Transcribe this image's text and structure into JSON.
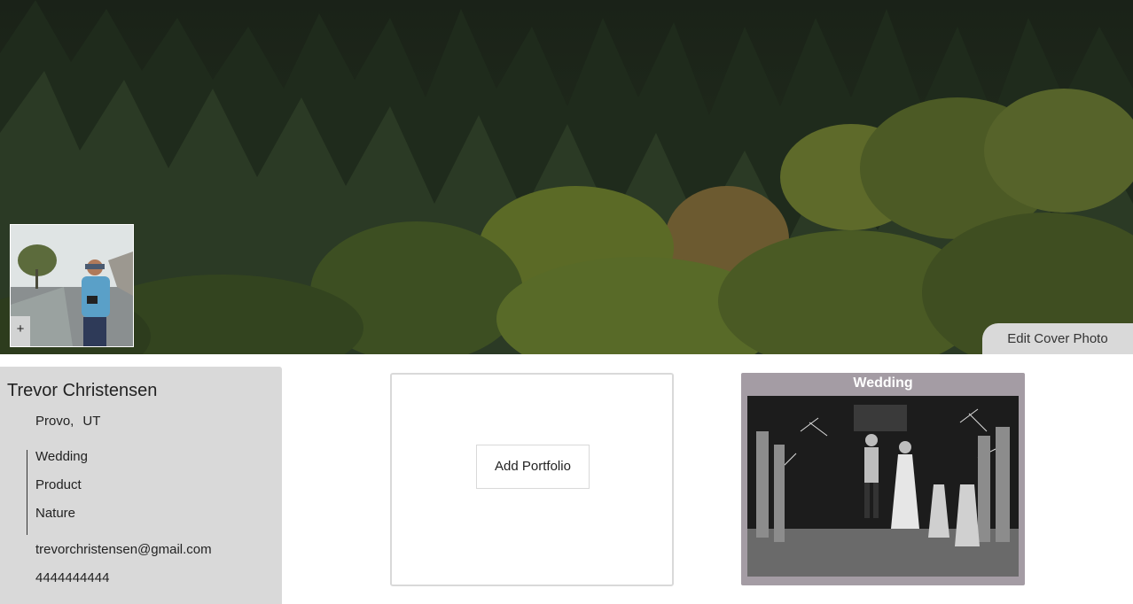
{
  "cover": {
    "image": "forest-treetops-photo",
    "edit_label": "Edit Cover Photo"
  },
  "avatar": {
    "image": "man-with-camera-and-horse-photo",
    "add_label": "+"
  },
  "profile": {
    "name": "Trevor Christensen",
    "city": "Provo,",
    "state": "UT",
    "specialties": [
      "Wedding",
      "Product",
      "Nature"
    ],
    "email": "trevorchristensen@gmail.com",
    "phone": "4444444444"
  },
  "add_portfolio": {
    "label": "Add Portfolio"
  },
  "portfolios": [
    {
      "title": "Wedding",
      "image": "wedding-sparkler-exit-bw-photo"
    }
  ],
  "colors": {
    "panel_gray": "#d9d9d9",
    "portfolio_card": "#a49ca4"
  }
}
